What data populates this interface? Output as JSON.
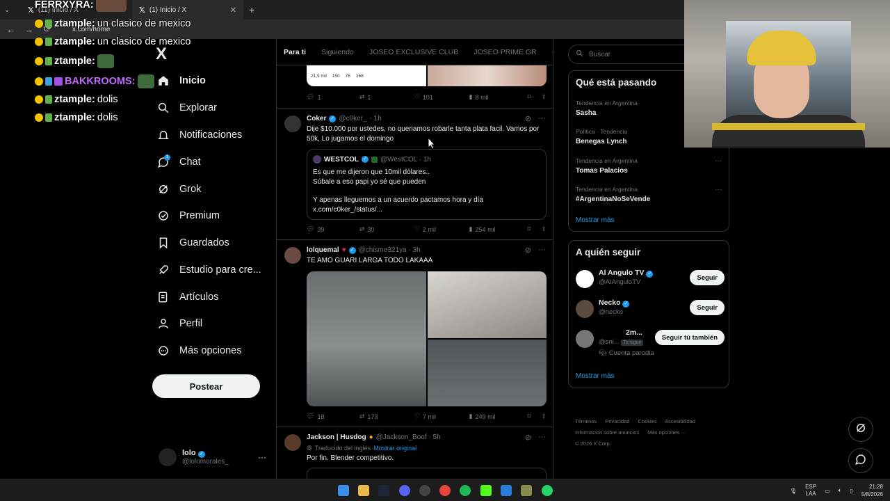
{
  "browser": {
    "tabs": [
      {
        "label": "(11) Inicio / X"
      },
      {
        "label": "(1) Inicio / X"
      }
    ],
    "new_tab": "+",
    "url": "x.com/home"
  },
  "sidebar": {
    "logo": "X",
    "items": [
      {
        "label": "Inicio",
        "icon": "home-icon"
      },
      {
        "label": "Explorar",
        "icon": "search-icon"
      },
      {
        "label": "Notificaciones",
        "icon": "bell-icon"
      },
      {
        "label": "Chat",
        "icon": "chat-icon",
        "badge": "1"
      },
      {
        "label": "Grok",
        "icon": "grok-icon"
      },
      {
        "label": "Premium",
        "icon": "premium-icon"
      },
      {
        "label": "Guardados",
        "icon": "bookmark-icon"
      },
      {
        "label": "Estudio para cre...",
        "icon": "rocket-icon"
      },
      {
        "label": "Artículos",
        "icon": "article-icon"
      },
      {
        "label": "Perfil",
        "icon": "person-icon"
      },
      {
        "label": "Más opciones",
        "icon": "more-icon"
      }
    ],
    "post_button": "Postear",
    "profile": {
      "name": "lolo",
      "handle": "@lolomorales_",
      "more": "···"
    }
  },
  "timeline": {
    "tabs": [
      "Para ti",
      "Siguiendo",
      "JOSEO EXCLUSIVE CLUB",
      "JOSEO PRIME GR"
    ],
    "tab_plus": "+",
    "tweets": [
      {
        "embedded_stats": [
          "21,9 mil",
          "150",
          "76",
          "168"
        ],
        "actions": {
          "replies": "1",
          "retweets": "1",
          "likes": "101",
          "views": "8 mil"
        }
      },
      {
        "name": "Coker",
        "handle": "@c0ker_",
        "time": "· 1h",
        "text": "Dije $10.000 por ustedes, no queriamos robarle tanta plata facil. Vamos por 50k, Lo jugamos el domingo",
        "quote": {
          "name": "WESTCOL",
          "handle": "@WestCOL · 1h",
          "line1": "Es que me dijeron que 10mil dólares..",
          "line2": "Súbale a eso papi yo sé que pueden",
          "line3": "Y apenas lleguemos a un acuerdo pactamos hora y día",
          "line4": "x.com/c0ker_/status/..."
        },
        "actions": {
          "replies": "39",
          "retweets": "30",
          "likes": "2 mil",
          "views": "254 mil"
        }
      },
      {
        "name": "lolquemal",
        "handle": "@chisme321ya · 3h",
        "text": "TE AMO GUARI LARGA TODO LAKAAA",
        "actions": {
          "replies": "18",
          "retweets": "173",
          "likes": "7 mil",
          "views": "249 mil"
        }
      },
      {
        "name": "Jackson | Husdog",
        "handle": "@Jackson_Boof · 5h",
        "translated": "Traducido del inglés",
        "show_original": "Mostrar original",
        "text": "Por fin. Blender competitivo."
      }
    ]
  },
  "right": {
    "search_placeholder": "Buscar",
    "trends_title": "Qué está pasando",
    "trends": [
      {
        "context": "Tendencia en Argentina",
        "title": "Sasha"
      },
      {
        "context": "Política · Tendencia",
        "title": "Benegas Lynch"
      },
      {
        "context": "Tendencia en Argentina",
        "title": "Tomas Palacios"
      },
      {
        "context": "Tendencia en Argentina",
        "title": "#ArgentinaNoSeVende"
      }
    ],
    "show_more": "Mostrar más",
    "follow_title": "A quién seguir",
    "follow": [
      {
        "name": "Al Angulo TV",
        "handle": "@AIAnguloTV",
        "button": "Seguir"
      },
      {
        "name": "Necko",
        "handle": "@necko",
        "button": "Seguir"
      },
      {
        "name": "2m...",
        "handle": "@sni...",
        "follows_you": "Te sigue",
        "extra": "Cuenta parodia",
        "button": "Seguir tú también"
      }
    ],
    "show_more_2": "Mostrar más",
    "footer": [
      "Términos",
      "Privacidad",
      "Cookies",
      "Accesibilidad",
      "Información sobre anuncios",
      "Más opciones ···",
      "© 2026 X Corp."
    ]
  },
  "stream_chat": [
    {
      "user": "FERRXYRA:",
      "msg": ""
    },
    {
      "user": "ztample:",
      "msg": "un clasico de mexico"
    },
    {
      "user": "ztample:",
      "msg": "un clasico de mexico"
    },
    {
      "user": "ztample:",
      "msg": ""
    },
    {
      "user": "BAKKROOMS:",
      "msg": ""
    },
    {
      "user": "ztample:",
      "msg": "dolis"
    },
    {
      "user": "ztample:",
      "msg": "dolis"
    }
  ],
  "taskbar": {
    "lang": "ESP",
    "lang2": "LAA",
    "time": "21:28",
    "date": "5/8/2026"
  }
}
